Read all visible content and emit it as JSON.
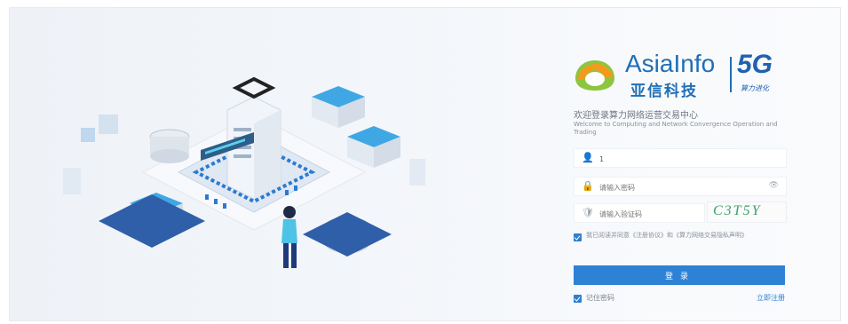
{
  "brand": {
    "name_en": "AsiaInfo",
    "name_cn": "亚信科技",
    "badge": "5G",
    "badge_sub": "算力进化"
  },
  "welcome": {
    "title_cn": "欢迎登录算力网络运营交易中心",
    "title_en": "Welcome to Computing and Network Convergence Operation and Trading"
  },
  "form": {
    "username_value": "1",
    "password_placeholder": "请输入密码",
    "captcha_placeholder": "请输入验证码",
    "captcha_text": "C3T5Y",
    "agreement_text": "我已阅读并同意《注册协议》和《算力网络交易隐私声明》",
    "login_label": "登录",
    "remember_label": "记住密码",
    "register_label": "立即注册"
  },
  "icons": {
    "user": "user-icon",
    "lock": "lock-icon",
    "shield": "shield-icon",
    "eye": "eye-icon"
  },
  "colors": {
    "primary": "#2e82d6",
    "brand_blue": "#1f6fb5",
    "logo_green": "#8cc63f",
    "logo_orange": "#f39a1e"
  }
}
